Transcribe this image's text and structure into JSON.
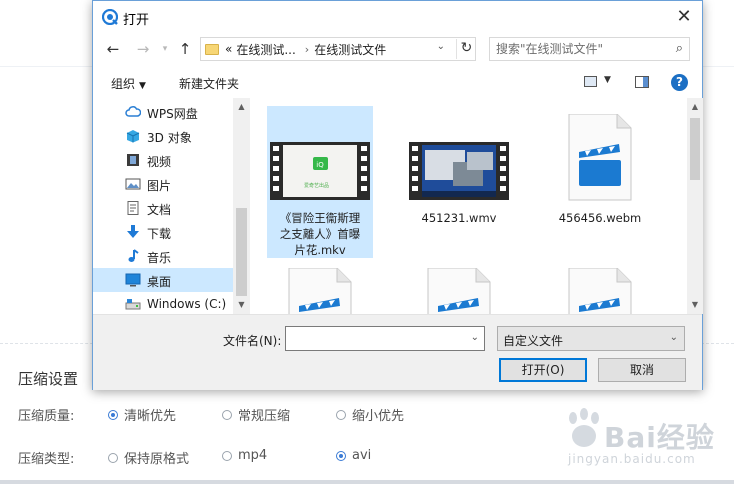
{
  "background": {
    "section_title": "压缩设置",
    "quality": {
      "label": "压缩质量:",
      "options": [
        "清晰优先",
        "常规压缩",
        "缩小优先"
      ],
      "selected": "清晰优先"
    },
    "type": {
      "label": "压缩类型:",
      "options": [
        "保持原格式",
        "mp4",
        "avi"
      ],
      "selected": "avi"
    },
    "watermark": {
      "brand": "Bai经验",
      "sub": "jingyan.baidu.com"
    }
  },
  "dialog": {
    "title": "打开",
    "close_glyph": "✕",
    "nav": {
      "back": "←",
      "forward": "→",
      "up": "↑",
      "refresh": "↻"
    },
    "address": {
      "prefix": "«",
      "crumbs": [
        "在线测试...",
        "在线测试文件"
      ],
      "separator": "›"
    },
    "search": {
      "placeholder": "搜索\"在线测试文件\"",
      "icon": "search-icon"
    },
    "toolbar": {
      "organize": "组织",
      "new_folder": "新建文件夹",
      "help": "?"
    },
    "nav_tree": [
      {
        "label": "WPS网盘",
        "icon": "cloud-icon"
      },
      {
        "label": "3D 对象",
        "icon": "cube-icon"
      },
      {
        "label": "视频",
        "icon": "video-icon"
      },
      {
        "label": "图片",
        "icon": "picture-icon"
      },
      {
        "label": "文档",
        "icon": "document-icon"
      },
      {
        "label": "下载",
        "icon": "download-icon"
      },
      {
        "label": "音乐",
        "icon": "music-icon"
      },
      {
        "label": "桌面",
        "icon": "desktop-icon",
        "selected": true
      },
      {
        "label": "Windows (C:)",
        "icon": "drive-icon"
      }
    ],
    "files": [
      {
        "name": "《冒险王衞斯理之支離人》首曝片花.mkv",
        "lines": [
          "《冒险王衞斯理",
          "之支離人》首曝",
          "片花.mkv"
        ],
        "selected": true,
        "thumb_text": "爱奇艺出品"
      },
      {
        "name": "451231.wmv",
        "lines": [
          "451231.wmv"
        ],
        "selected": false
      },
      {
        "name": "456456.webm",
        "lines": [
          "456456.webm"
        ],
        "selected": false
      }
    ],
    "filename_label": "文件名(N):",
    "filename_value": "",
    "filter_value": "自定义文件",
    "open_button": "打开(O)",
    "cancel_button": "取消",
    "accent_color": "#0078d7",
    "selection_color": "#cce8ff"
  }
}
